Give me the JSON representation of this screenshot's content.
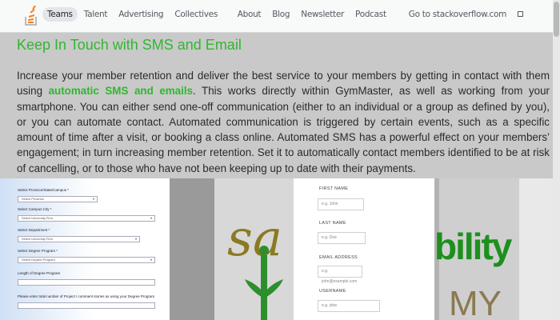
{
  "nav": {
    "left": [
      "Teams",
      "Talent",
      "Advertising",
      "Collectives"
    ],
    "right": [
      "About",
      "Blog",
      "Newsletter",
      "Podcast",
      "Go to stackoverflow.com"
    ]
  },
  "article": {
    "heading": "Keep In Touch with SMS and Email",
    "para_before": "Increase your member retention and deliver the best service to your members by getting in contact with them using ",
    "para_link": "automatic SMS and emails",
    "para_after": ". This works directly within GymMaster, as well as working from your smartphone. You can either send one-off communication (either to an individual or a group as defined by you), or you can automate contact. Automated communication is triggered by certain events, such as a specific amount of time after a visit, or booking a class online. Automated SMS has a powerful effect on your members’ engagement; in turn increasing member retention. Set it to automatically contact members identified to be at risk of cancelling, or to those who have not been keeping up to date with their payments."
  },
  "collage": {
    "form": {
      "fields": [
        {
          "label": "Select Province/State/Campus *",
          "value": "Select Province"
        },
        {
          "label": "Select Campus City *",
          "value": "Select University First"
        },
        {
          "label": "Select Department *",
          "value": "Select University First"
        },
        {
          "label": "Select Degree Program *",
          "value": "Select Degree Program"
        },
        {
          "label": "Length of Degree Program",
          "value": ""
        },
        {
          "label": "Please enter total number of Project / comment stories as using your Degree Program",
          "value": ""
        }
      ]
    },
    "signup": {
      "fields": [
        {
          "label": "FIRST NAME",
          "placeholder": "e.g. John"
        },
        {
          "label": "LAST NAME",
          "placeholder": "e.g. Doe"
        },
        {
          "label": "EMAIL ADDRESS",
          "placeholder": "e.g. john@example.com"
        },
        {
          "label": "USERNAME",
          "placeholder": "e.g. jdoe"
        }
      ]
    },
    "brand_text": "bility",
    "brand_text2": "MY"
  },
  "colors": {
    "accent": "#2eb82e",
    "brand_green": "#1e8f1e",
    "overlay": "#c9c9c9",
    "stack_orange": "#f48024"
  }
}
